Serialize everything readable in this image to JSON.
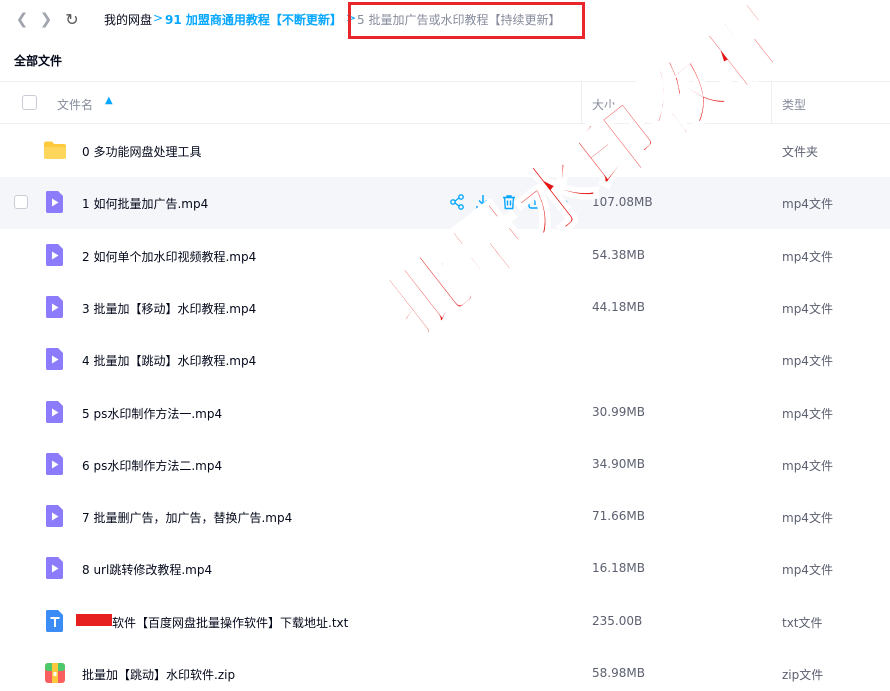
{
  "breadcrumb": {
    "root": "我的网盘",
    "sep1": ">",
    "mid": "91 加盟商通用教程【不断更新】",
    "sep2": ">",
    "current": "5 批量加广告或水印教程【持续更新】"
  },
  "section_title": "全部文件",
  "columns": {
    "name": "文件名",
    "size": "大小",
    "type": "类型"
  },
  "files": [
    {
      "icon": "folder-icon",
      "name": "0 多功能网盘处理工具",
      "size": "-",
      "type": "文件夹"
    },
    {
      "icon": "video-file-icon",
      "name": "1 如何批量加广告.mp4",
      "size": "107.08MB",
      "type": "mp4文件"
    },
    {
      "icon": "video-file-icon",
      "name": "2 如何单个加水印视频教程.mp4",
      "size": "54.38MB",
      "type": "mp4文件"
    },
    {
      "icon": "video-file-icon",
      "name": "3 批量加【移动】水印教程.mp4",
      "size": "44.18MB",
      "type": "mp4文件"
    },
    {
      "icon": "video-file-icon",
      "name": "4 批量加【跳动】水印教程.mp4",
      "size": "",
      "type": "mp4文件"
    },
    {
      "icon": "video-file-icon",
      "name": "5 ps水印制作方法一.mp4",
      "size": "30.99MB",
      "type": "mp4文件"
    },
    {
      "icon": "video-file-icon",
      "name": "6 ps水印制作方法二.mp4",
      "size": "34.90MB",
      "type": "mp4文件"
    },
    {
      "icon": "video-file-icon",
      "name": "7 批量删广告，加广告，替换广告.mp4",
      "size": "71.66MB",
      "type": "mp4文件"
    },
    {
      "icon": "video-file-icon",
      "name": "8 url跳转修改教程.mp4",
      "size": "16.18MB",
      "type": "mp4文件"
    },
    {
      "icon": "text-file-icon",
      "name": "软件【百度网盘批量操作软件】下载地址.txt",
      "size": "235.00B",
      "type": "txt文件"
    },
    {
      "icon": "zip-file-icon",
      "name": "批量加【跳动】水印软件.zip",
      "size": "58.98MB",
      "type": "zip文件"
    }
  ],
  "watermark": "批量水印教程",
  "colors": {
    "accent": "#06a7ff",
    "video_icon": "#8c7bfa",
    "folder": "#ffc93d",
    "highlight_box": "#e8262b",
    "watermark": "#e51313"
  }
}
